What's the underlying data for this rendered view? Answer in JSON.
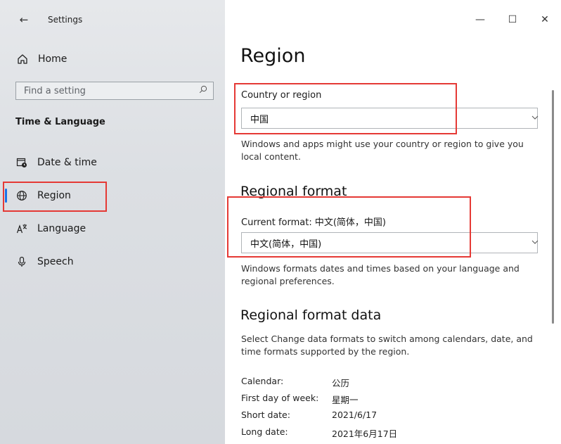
{
  "window": {
    "app_title": "Settings",
    "controls": {
      "minimize": "—",
      "maximize": "☐",
      "close": "✕"
    }
  },
  "sidebar": {
    "home_label": "Home",
    "search_placeholder": "Find a setting",
    "section_title": "Time & Language",
    "items": [
      {
        "label": "Date & time",
        "icon": "calendar-clock-icon"
      },
      {
        "label": "Region",
        "icon": "globe-icon",
        "active": true
      },
      {
        "label": "Language",
        "icon": "language-icon"
      },
      {
        "label": "Speech",
        "icon": "microphone-icon"
      }
    ]
  },
  "main": {
    "title": "Region",
    "country": {
      "label": "Country or region",
      "value": "中国",
      "description": "Windows and apps might use your country or region to give you local content."
    },
    "regional_format": {
      "heading": "Regional format",
      "current_label": "Current format: 中文(简体，中国)",
      "value": "中文(简体，中国)",
      "description": "Windows formats dates and times based on your language and regional preferences."
    },
    "format_data": {
      "heading": "Regional format data",
      "description": "Select Change data formats to switch among calendars, date, and time formats supported by the region.",
      "rows": [
        {
          "key": "Calendar:",
          "value": "公历"
        },
        {
          "key": "First day of week:",
          "value": "星期一"
        },
        {
          "key": "Short date:",
          "value": "2021/6/17"
        },
        {
          "key": "Long date:",
          "value": "2021年6月17日"
        }
      ]
    }
  },
  "colors": {
    "accent": "#1a73e8",
    "highlight_box": "#e53935"
  }
}
